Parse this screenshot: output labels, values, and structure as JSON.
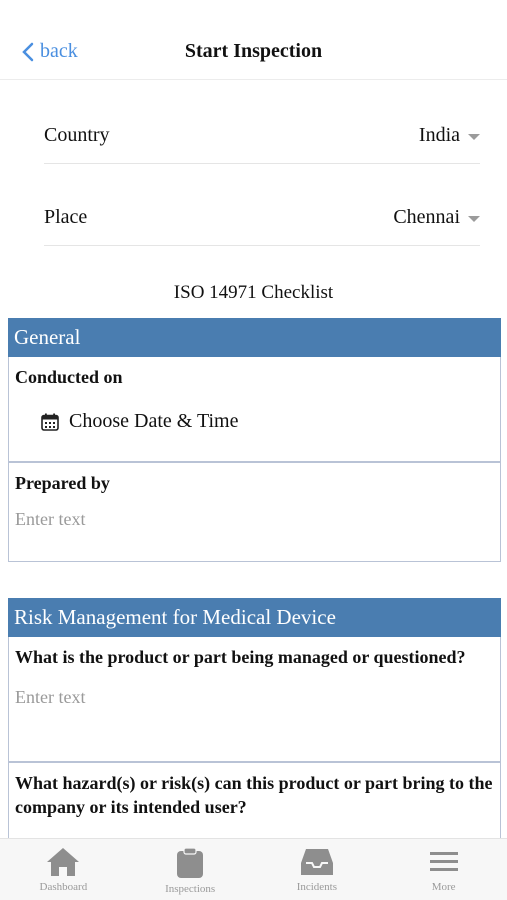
{
  "header": {
    "back_label": "back",
    "title": "Start Inspection"
  },
  "fields": [
    {
      "label": "Country",
      "value": "India"
    },
    {
      "label": "Place",
      "value": "Chennai"
    }
  ],
  "checklist_title": "ISO 14971 Checklist",
  "sections": [
    {
      "title": "General",
      "conducted_label": "Conducted on",
      "date_placeholder": "Choose Date & Time",
      "prepared_label": "Prepared by",
      "prepared_placeholder": "Enter text"
    },
    {
      "title": "Risk Management for Medical Device",
      "q1": "What is the product or part being managed or questioned?",
      "q1_placeholder": "Enter text",
      "q2": "What hazard(s) or risk(s) can this product or part bring to the company or its intended user?"
    }
  ],
  "tabbar": [
    {
      "label": "Dashboard",
      "icon": "home-icon"
    },
    {
      "label": "Inspections",
      "icon": "clipboard-icon"
    },
    {
      "label": "Incidents",
      "icon": "inbox-icon"
    },
    {
      "label": "More",
      "icon": "menu-icon"
    }
  ],
  "colors": {
    "accent": "#4a8fe0",
    "section_header": "#4a7db0",
    "tab_icon": "#8e8e8e"
  }
}
